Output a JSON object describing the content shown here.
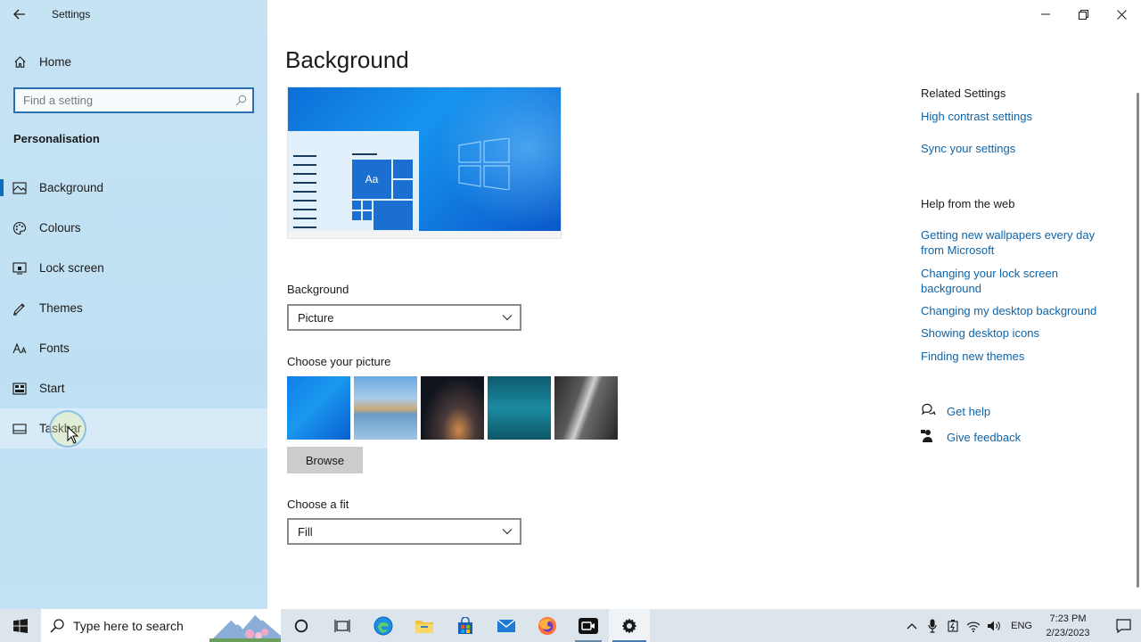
{
  "window": {
    "title": "Settings"
  },
  "sidebar": {
    "home_label": "Home",
    "search_placeholder": "Find a setting",
    "section_title": "Personalisation",
    "items": [
      {
        "label": "Background",
        "icon": "picture-icon",
        "selected": true
      },
      {
        "label": "Colours",
        "icon": "palette-icon"
      },
      {
        "label": "Lock screen",
        "icon": "lock-screen-icon"
      },
      {
        "label": "Themes",
        "icon": "themes-icon"
      },
      {
        "label": "Fonts",
        "icon": "fonts-icon"
      },
      {
        "label": "Start",
        "icon": "start-icon"
      },
      {
        "label": "Taskbar",
        "icon": "taskbar-icon",
        "hover": true
      }
    ]
  },
  "main": {
    "title": "Background",
    "preview_tile_text": "Aa",
    "background_label": "Background",
    "background_value": "Picture",
    "choose_picture_label": "Choose your picture",
    "browse_label": "Browse",
    "fit_label": "Choose a fit",
    "fit_value": "Fill"
  },
  "related": {
    "heading": "Related Settings",
    "links": [
      "High contrast settings",
      "Sync your settings"
    ]
  },
  "help": {
    "heading": "Help from the web",
    "links": [
      "Getting new wallpapers every day from Microsoft",
      "Changing your lock screen background",
      "Changing my desktop background",
      "Showing desktop icons",
      "Finding new themes"
    ],
    "get_help": "Get help",
    "give_feedback": "Give feedback"
  },
  "taskbar": {
    "search_placeholder": "Type here to search",
    "language": "ENG",
    "time": "7:23 PM",
    "date": "2/23/2023"
  },
  "colors": {
    "accent": "#0f6cbd",
    "link": "#0f64a8",
    "sidebar_bg": "#c6e3f4",
    "taskbar_bg": "#dde5ec"
  }
}
